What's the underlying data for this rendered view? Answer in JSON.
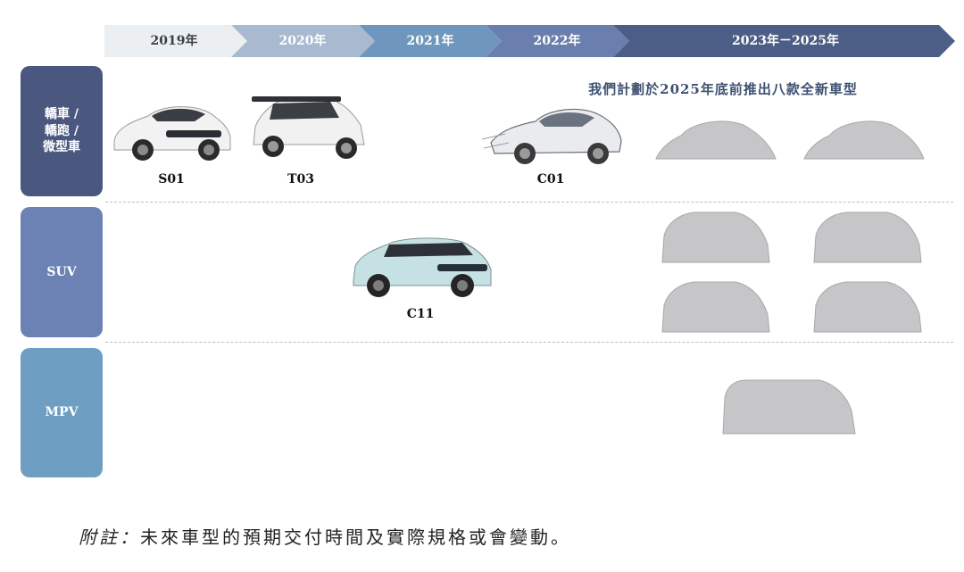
{
  "timeline": {
    "stages": [
      {
        "label": "2019年",
        "color": "#eceff2",
        "text_color": "#3a3f48"
      },
      {
        "label": "2020年",
        "color": "#a8b9d0",
        "text_color": "#ffffff"
      },
      {
        "label": "2021年",
        "color": "#6f97be",
        "text_color": "#ffffff"
      },
      {
        "label": "2022年",
        "color": "#6b7fae",
        "text_color": "#ffffff"
      },
      {
        "label": "2023年－2025年",
        "color": "#4d5e86",
        "text_color": "#ffffff"
      }
    ]
  },
  "categories": [
    {
      "label_lines": [
        "轎車 /",
        "轎跑 /",
        "微型車"
      ],
      "color": "#4a5880"
    },
    {
      "label_lines": [
        "SUV"
      ],
      "color": "#6c82b4"
    },
    {
      "label_lines": [
        "MPV"
      ],
      "color": "#6f9ec3"
    }
  ],
  "plan_text": "我們計劃於2025年底前推出八款全新車型",
  "models": {
    "s01": "S01",
    "t03": "T03",
    "c01": "C01",
    "c11": "C11"
  },
  "colors": {
    "covered_car": "#c6c6c8",
    "divider": "#b9bec8"
  },
  "note": {
    "lead": "附註：",
    "text": "未來車型的預期交付時間及實際規格或會變動。"
  }
}
